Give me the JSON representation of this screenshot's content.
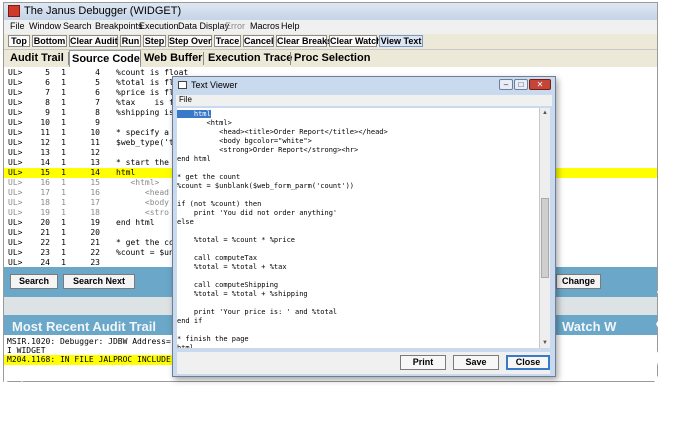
{
  "window": {
    "title": "The Janus Debugger (WIDGET)"
  },
  "menubar": [
    {
      "label": "File",
      "disabled": false
    },
    {
      "label": "Window",
      "disabled": false
    },
    {
      "label": "Search",
      "disabled": false
    },
    {
      "label": "Breakpoints",
      "disabled": false
    },
    {
      "label": "Execution",
      "disabled": false
    },
    {
      "label": "Data Display",
      "disabled": false
    },
    {
      "label": "Error",
      "disabled": true
    },
    {
      "label": "Macros",
      "disabled": false
    },
    {
      "label": "Help",
      "disabled": false
    }
  ],
  "toolbar": [
    "Top",
    "Bottom",
    "Clear Audit",
    "Run",
    "Step",
    "Step Over",
    "Trace",
    "Cancel",
    "Clear Breaks",
    "Clear Watch",
    "View Text"
  ],
  "tabs": [
    "Audit Trail",
    "Source Code",
    "Web Buffer",
    "Execution Trace",
    "Proc Selection"
  ],
  "code_lines": [
    {
      "ul": "UL>",
      "a": "5",
      "b": "1",
      "c": "4",
      "code": "%count is float",
      "hl": false,
      "dim": false
    },
    {
      "ul": "UL>",
      "a": "6",
      "b": "1",
      "c": "5",
      "code": "%total is fl",
      "hl": false,
      "dim": false
    },
    {
      "ul": "UL>",
      "a": "7",
      "b": "1",
      "c": "6",
      "code": "%price is fl",
      "hl": false,
      "dim": false
    },
    {
      "ul": "UL>",
      "a": "8",
      "b": "1",
      "c": "7",
      "code": "%tax    is fl",
      "hl": false,
      "dim": false
    },
    {
      "ul": "UL>",
      "a": "9",
      "b": "1",
      "c": "8",
      "code": "%shipping is",
      "hl": false,
      "dim": false
    },
    {
      "ul": "UL>",
      "a": "10",
      "b": "1",
      "c": "9",
      "code": "",
      "hl": false,
      "dim": false
    },
    {
      "ul": "UL>",
      "a": "11",
      "b": "1",
      "c": "10",
      "code": "* specify a",
      "hl": false,
      "dim": false
    },
    {
      "ul": "UL>",
      "a": "12",
      "b": "1",
      "c": "11",
      "code": "$web_type('t",
      "hl": false,
      "dim": false
    },
    {
      "ul": "UL>",
      "a": "13",
      "b": "1",
      "c": "12",
      "code": "",
      "hl": false,
      "dim": false
    },
    {
      "ul": "UL>",
      "a": "14",
      "b": "1",
      "c": "13",
      "code": "* start the",
      "hl": false,
      "dim": false
    },
    {
      "ul": "UL>",
      "a": "15",
      "b": "1",
      "c": "14",
      "code": "html",
      "hl": true,
      "dim": false
    },
    {
      "ul": "UL>",
      "a": "16",
      "b": "1",
      "c": "15",
      "code": "   <html>",
      "hl": false,
      "dim": true
    },
    {
      "ul": "UL>",
      "a": "17",
      "b": "1",
      "c": "16",
      "code": "      <head",
      "hl": false,
      "dim": true
    },
    {
      "ul": "UL>",
      "a": "18",
      "b": "1",
      "c": "17",
      "code": "      <body",
      "hl": false,
      "dim": true
    },
    {
      "ul": "UL>",
      "a": "19",
      "b": "1",
      "c": "18",
      "code": "      <stro",
      "hl": false,
      "dim": true
    },
    {
      "ul": "UL>",
      "a": "20",
      "b": "1",
      "c": "19",
      "code": "end html",
      "hl": false,
      "dim": false
    },
    {
      "ul": "UL>",
      "a": "21",
      "b": "1",
      "c": "20",
      "code": "",
      "hl": false,
      "dim": false
    },
    {
      "ul": "UL>",
      "a": "22",
      "b": "1",
      "c": "21",
      "code": "* get the co",
      "hl": false,
      "dim": false
    },
    {
      "ul": "UL>",
      "a": "23",
      "b": "1",
      "c": "22",
      "code": "%count = $un",
      "hl": false,
      "dim": false
    },
    {
      "ul": "UL>",
      "a": "24",
      "b": "1",
      "c": "23",
      "code": "",
      "hl": false,
      "dim": false
    }
  ],
  "search_buttons": [
    "Search",
    "Search Next"
  ],
  "watch_button": "Change",
  "audit_header": "Most Recent Audit Trail",
  "watch_header": "Watch W",
  "audit_lines": [
    {
      "text": "MSIR.1020: Debugger: JDBW Address=",
      "hl": false
    },
    {
      "text": "I WIDGET",
      "hl": false
    },
    {
      "text": "M204.1168: IN FILE JALPROC INCLUDE",
      "hl": true
    }
  ],
  "viewer": {
    "title": "Text Viewer",
    "menu": "File",
    "lines": [
      "    html",
      "       <html>",
      "          <head><title>Order Report</title></head>",
      "          <body bgcolor=\"white\">",
      "          <strong>Order Report</strong><hr>",
      "end html",
      "",
      "* get the count",
      "%count = $unblank($web_form_parm('count'))",
      "",
      "if (not %count) then",
      "    print 'You did not order anything'",
      "else",
      "",
      "    %total = %count * %price",
      "",
      "    call computeTax",
      "    %total = %total + %tax",
      "",
      "    call computeShipping",
      "    %total = %total + %shipping",
      "",
      "    print 'Your price is: ' and %total",
      "end if",
      "",
      "* finish the page",
      "html"
    ],
    "buttons": [
      "Print",
      "Save",
      "Close"
    ]
  }
}
